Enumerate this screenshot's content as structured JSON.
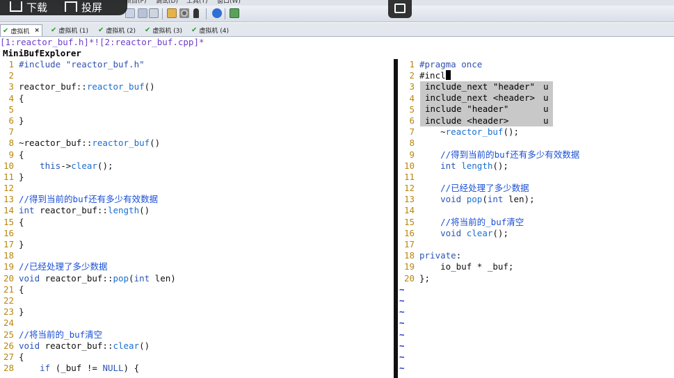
{
  "overlay": {
    "download_label": "下载",
    "cast_label": "投屏"
  },
  "menubar": [
    "项目(P)",
    "调试(D)",
    "工具(T)",
    "窗口(W)"
  ],
  "tabs": [
    {
      "label": "虚拟机",
      "active": true,
      "close": "×"
    },
    {
      "label": "虚拟机 (1)"
    },
    {
      "label": "虚拟机 (2)"
    },
    {
      "label": "虚拟机 (3)"
    },
    {
      "label": "虚拟机 (4)"
    }
  ],
  "buffer_list": "[1:reactor_buf.h]*![2:reactor_buf.cpp]*",
  "minibuf_title": "MiniBufExplorer",
  "left_pane": [
    {
      "n": "1",
      "parts": [
        [
          "pp",
          "#include \"reactor_buf.h\""
        ]
      ]
    },
    {
      "n": "2",
      "parts": []
    },
    {
      "n": "3",
      "parts": [
        [
          "tx",
          "reactor_buf::"
        ],
        [
          "fn",
          "reactor_buf"
        ],
        [
          "tx",
          "()"
        ]
      ]
    },
    {
      "n": "4",
      "parts": [
        [
          "tx",
          "{"
        ]
      ]
    },
    {
      "n": "5",
      "parts": []
    },
    {
      "n": "6",
      "parts": [
        [
          "tx",
          "}"
        ]
      ]
    },
    {
      "n": "7",
      "parts": []
    },
    {
      "n": "8",
      "parts": [
        [
          "tx",
          "~reactor_buf::"
        ],
        [
          "fn",
          "reactor_buf"
        ],
        [
          "tx",
          "()"
        ]
      ]
    },
    {
      "n": "9",
      "parts": [
        [
          "tx",
          "{"
        ]
      ]
    },
    {
      "n": "10",
      "parts": [
        [
          "tx",
          "    "
        ],
        [
          "kw",
          "this"
        ],
        [
          "tx",
          "->"
        ],
        [
          "fn",
          "clear"
        ],
        [
          "tx",
          "();"
        ]
      ]
    },
    {
      "n": "11",
      "parts": [
        [
          "tx",
          "}"
        ]
      ]
    },
    {
      "n": "12",
      "parts": []
    },
    {
      "n": "13",
      "parts": [
        [
          "cm",
          "//得到当前的buf还有多少有效数据"
        ]
      ]
    },
    {
      "n": "14",
      "parts": [
        [
          "kw",
          "int"
        ],
        [
          "tx",
          " reactor_buf::"
        ],
        [
          "fn",
          "length"
        ],
        [
          "tx",
          "()"
        ]
      ]
    },
    {
      "n": "15",
      "parts": [
        [
          "tx",
          "{"
        ]
      ]
    },
    {
      "n": "16",
      "parts": []
    },
    {
      "n": "17",
      "parts": [
        [
          "tx",
          "}"
        ]
      ]
    },
    {
      "n": "18",
      "parts": []
    },
    {
      "n": "19",
      "parts": [
        [
          "cm",
          "//已经处理了多少数据"
        ]
      ]
    },
    {
      "n": "20",
      "parts": [
        [
          "kw",
          "void"
        ],
        [
          "tx",
          " reactor_buf::"
        ],
        [
          "fn",
          "pop"
        ],
        [
          "tx",
          "("
        ],
        [
          "kw",
          "int"
        ],
        [
          "tx",
          " len)"
        ]
      ]
    },
    {
      "n": "21",
      "parts": [
        [
          "tx",
          "{"
        ]
      ]
    },
    {
      "n": "22",
      "parts": []
    },
    {
      "n": "23",
      "parts": [
        [
          "tx",
          "}"
        ]
      ]
    },
    {
      "n": "24",
      "parts": []
    },
    {
      "n": "25",
      "parts": [
        [
          "cm",
          "//将当前的_buf清空"
        ]
      ]
    },
    {
      "n": "26",
      "parts": [
        [
          "kw",
          "void"
        ],
        [
          "tx",
          " reactor_buf::"
        ],
        [
          "fn",
          "clear"
        ],
        [
          "tx",
          "()"
        ]
      ]
    },
    {
      "n": "27",
      "parts": [
        [
          "tx",
          "{"
        ]
      ]
    },
    {
      "n": "28",
      "parts": [
        [
          "tx",
          "    "
        ],
        [
          "kw",
          "if"
        ],
        [
          "tx",
          " (_buf != "
        ],
        [
          "kw",
          "NULL"
        ],
        [
          "tx",
          ") {"
        ]
      ]
    }
  ],
  "right_pane": [
    {
      "n": "1",
      "parts": [
        [
          "pp",
          "#pragma once"
        ]
      ]
    },
    {
      "n": "2",
      "parts": [
        [
          "tx",
          "#incl"
        ]
      ],
      "cursor": true
    },
    {
      "n": "3",
      "parts": []
    },
    {
      "n": "4",
      "parts": []
    },
    {
      "n": "5",
      "parts": []
    },
    {
      "n": "6",
      "parts": []
    },
    {
      "n": "7",
      "parts": [
        [
          "tx",
          "    ~"
        ],
        [
          "fn",
          "reactor_buf"
        ],
        [
          "tx",
          "();"
        ]
      ]
    },
    {
      "n": "8",
      "parts": []
    },
    {
      "n": "9",
      "parts": [
        [
          "tx",
          "    "
        ],
        [
          "cm",
          "//得到当前的buf还有多少有效数据"
        ]
      ]
    },
    {
      "n": "10",
      "parts": [
        [
          "tx",
          "    "
        ],
        [
          "kw",
          "int"
        ],
        [
          "tx",
          " "
        ],
        [
          "fn",
          "length"
        ],
        [
          "tx",
          "();"
        ]
      ]
    },
    {
      "n": "11",
      "parts": []
    },
    {
      "n": "12",
      "parts": [
        [
          "tx",
          "    "
        ],
        [
          "cm",
          "//已经处理了多少数据"
        ]
      ]
    },
    {
      "n": "13",
      "parts": [
        [
          "tx",
          "    "
        ],
        [
          "kw",
          "void"
        ],
        [
          "tx",
          " "
        ],
        [
          "fn",
          "pop"
        ],
        [
          "tx",
          "("
        ],
        [
          "kw",
          "int"
        ],
        [
          "tx",
          " len);"
        ]
      ]
    },
    {
      "n": "14",
      "parts": []
    },
    {
      "n": "15",
      "parts": [
        [
          "tx",
          "    "
        ],
        [
          "cm",
          "//将当前的_buf清空"
        ]
      ]
    },
    {
      "n": "16",
      "parts": [
        [
          "tx",
          "    "
        ],
        [
          "kw",
          "void"
        ],
        [
          "tx",
          " "
        ],
        [
          "fn",
          "clear"
        ],
        [
          "tx",
          "();"
        ]
      ]
    },
    {
      "n": "17",
      "parts": []
    },
    {
      "n": "18",
      "parts": [
        [
          "kw",
          "private"
        ],
        [
          "tx",
          ":"
        ]
      ]
    },
    {
      "n": "19",
      "parts": [
        [
          "tx",
          "    io_buf * _buf;"
        ]
      ]
    },
    {
      "n": "20",
      "parts": [
        [
          "tx",
          "};"
        ]
      ]
    }
  ],
  "completion_popup": [
    {
      "text": "include_next \"header\"",
      "kind": "u"
    },
    {
      "text": "include_next <header>",
      "kind": "u"
    },
    {
      "text": "include \"header\"",
      "kind": "u"
    },
    {
      "text": "include <header>",
      "kind": "u"
    }
  ],
  "tilde_char": "~",
  "tilde_count": 8
}
